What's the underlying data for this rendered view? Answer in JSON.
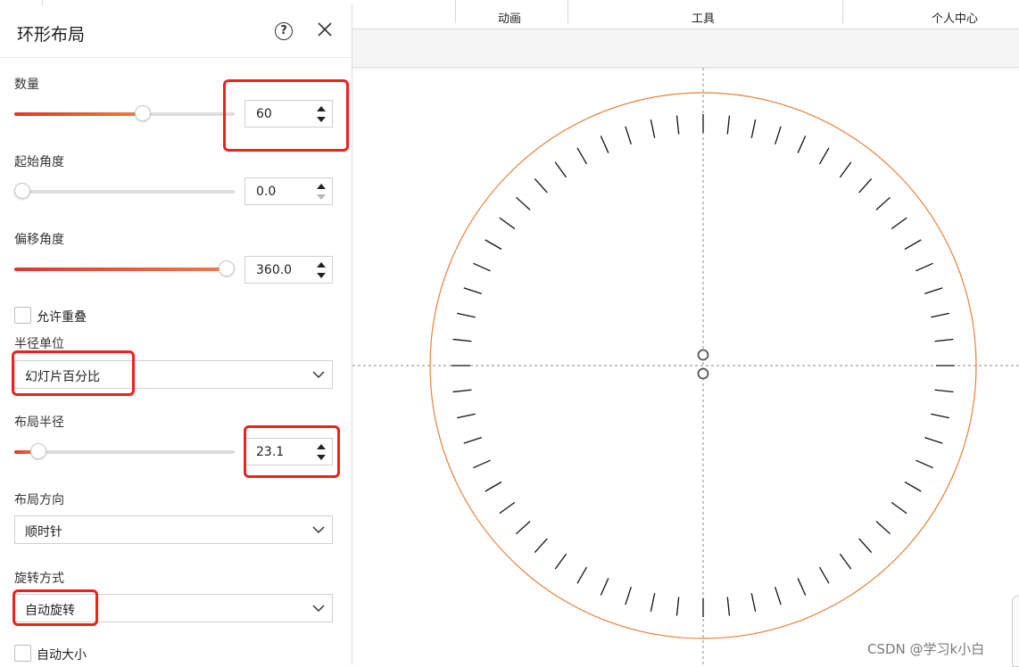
{
  "ribbon": {
    "tabs": [
      {
        "label": "动画"
      },
      {
        "label": "工具"
      },
      {
        "label": "个人中心"
      }
    ]
  },
  "panel": {
    "title": "环形布局",
    "help_glyph": "?",
    "count": {
      "label": "数量",
      "value": "60",
      "slider_level": 0.59
    },
    "start_angle": {
      "label": "起始角度",
      "value": "0.0",
      "slider_level": 0.0
    },
    "offset_angle": {
      "label": "偏移角度",
      "value": "360.0",
      "slider_level": 1.0
    },
    "allow_overlap": {
      "label": "允许重叠",
      "checked": false
    },
    "radius_unit": {
      "label": "半径单位",
      "value": "幻灯片百分比"
    },
    "layout_radius": {
      "label": "布局半径",
      "value": "23.1",
      "slider_level": 0.08
    },
    "direction": {
      "label": "布局方向",
      "value": "顺时针"
    },
    "rotation": {
      "label": "旋转方式",
      "value": "自动旋转"
    },
    "auto_size": {
      "label": "自动大小",
      "checked": false
    }
  },
  "canvas": {
    "tick_count": 60,
    "circle_color": "#e8813a",
    "tick_color": "#111111",
    "guide_color": "#8a8a8a"
  },
  "colors": {
    "accent": "#e0362c",
    "highlight": "#f0201c"
  },
  "watermark": "CSDN @学习k小白"
}
